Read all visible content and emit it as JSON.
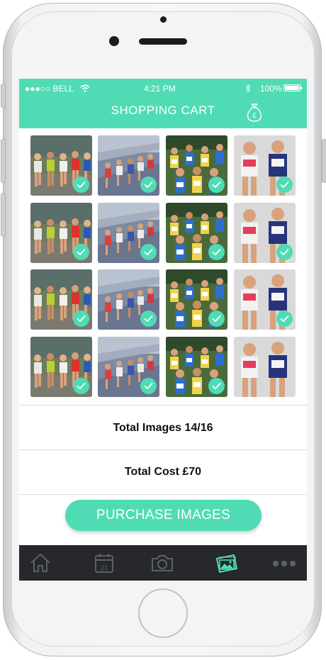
{
  "status_bar": {
    "carrier": "●●●○○ BELL",
    "time": "4:21 PM",
    "battery": "100%"
  },
  "nav": {
    "title": "SHOPPING CART",
    "icon": "money-bag-icon"
  },
  "cart": {
    "images": [
      {
        "photo": "runners-city",
        "selected": true
      },
      {
        "photo": "runners-bridge",
        "selected": true
      },
      {
        "photo": "runners-crowd",
        "selected": true
      },
      {
        "photo": "runners-closeup",
        "selected": true
      },
      {
        "photo": "runners-city",
        "selected": true
      },
      {
        "photo": "runners-bridge",
        "selected": true
      },
      {
        "photo": "runners-crowd",
        "selected": true
      },
      {
        "photo": "runners-closeup",
        "selected": true
      },
      {
        "photo": "runners-city",
        "selected": true
      },
      {
        "photo": "runners-bridge",
        "selected": true
      },
      {
        "photo": "runners-crowd",
        "selected": true
      },
      {
        "photo": "runners-closeup",
        "selected": true
      },
      {
        "photo": "runners-city",
        "selected": true
      },
      {
        "photo": "runners-bridge",
        "selected": true
      },
      {
        "photo": "runners-crowd",
        "selected": true
      },
      {
        "photo": "runners-closeup",
        "selected": false
      }
    ]
  },
  "summary": {
    "total_images": "Total Images 14/16",
    "total_cost": "Total Cost £70"
  },
  "purchase_label": "PURCHASE IMAGES",
  "tabs": [
    {
      "icon": "home-icon",
      "active": false
    },
    {
      "icon": "calendar-icon",
      "active": false,
      "text": "21"
    },
    {
      "icon": "camera-icon",
      "active": false
    },
    {
      "icon": "gallery-icon",
      "active": true
    },
    {
      "icon": "more-icon",
      "active": false
    }
  ],
  "colors": {
    "accent": "#4fdcb4",
    "tab_bar": "#26282b",
    "tab_inactive": "#5d6064"
  }
}
